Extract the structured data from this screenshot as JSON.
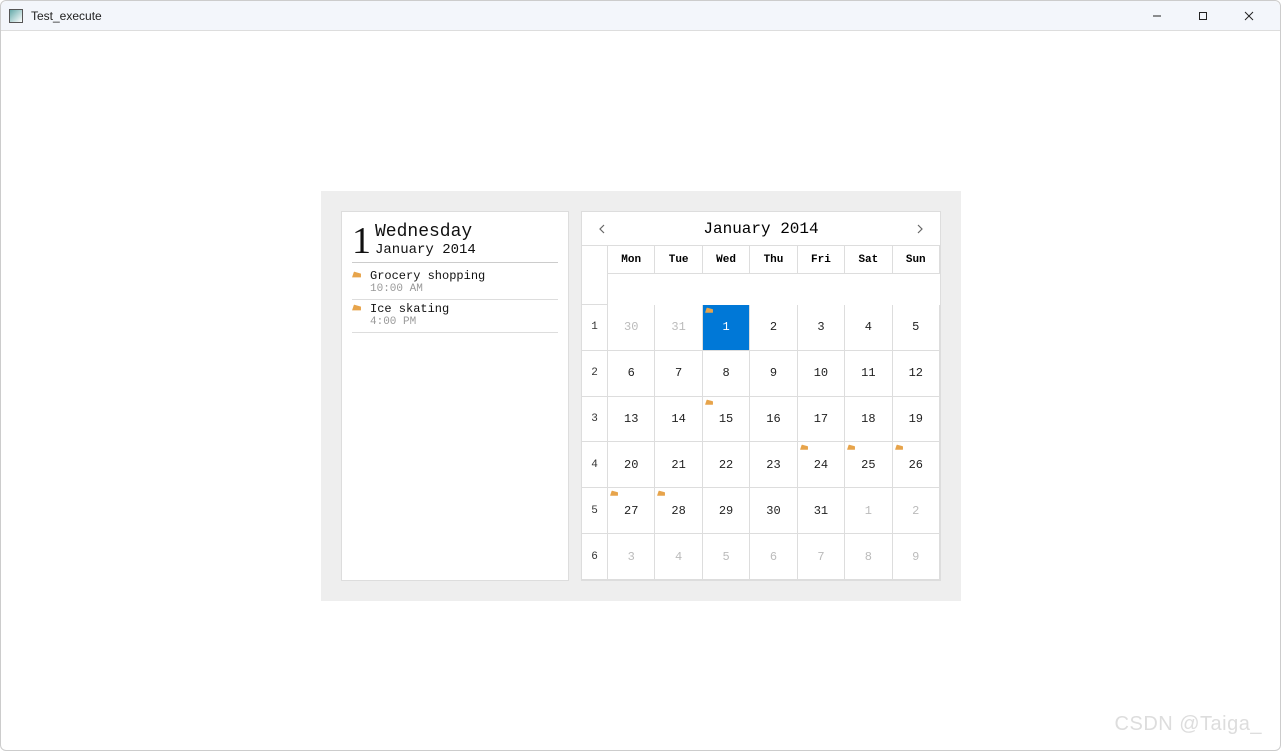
{
  "window": {
    "title": "Test_execute"
  },
  "day_panel": {
    "day_number": "1",
    "weekday": "Wednesday",
    "month_year": "January 2014",
    "events": [
      {
        "title": "Grocery shopping",
        "time": "10:00 AM"
      },
      {
        "title": "Ice skating",
        "time": "4:00 PM"
      }
    ]
  },
  "calendar": {
    "title": "January 2014",
    "dow": [
      "Mon",
      "Tue",
      "Wed",
      "Thu",
      "Fri",
      "Sat",
      "Sun"
    ],
    "weeks": [
      {
        "wk": "1",
        "days": [
          {
            "n": "30",
            "other": true
          },
          {
            "n": "31",
            "other": true
          },
          {
            "n": "1",
            "selected": true,
            "marker": true
          },
          {
            "n": "2"
          },
          {
            "n": "3"
          },
          {
            "n": "4"
          },
          {
            "n": "5"
          }
        ]
      },
      {
        "wk": "2",
        "days": [
          {
            "n": "6"
          },
          {
            "n": "7"
          },
          {
            "n": "8"
          },
          {
            "n": "9"
          },
          {
            "n": "10"
          },
          {
            "n": "11"
          },
          {
            "n": "12"
          }
        ]
      },
      {
        "wk": "3",
        "days": [
          {
            "n": "13"
          },
          {
            "n": "14"
          },
          {
            "n": "15",
            "marker": true
          },
          {
            "n": "16"
          },
          {
            "n": "17"
          },
          {
            "n": "18"
          },
          {
            "n": "19"
          }
        ]
      },
      {
        "wk": "4",
        "days": [
          {
            "n": "20"
          },
          {
            "n": "21"
          },
          {
            "n": "22"
          },
          {
            "n": "23"
          },
          {
            "n": "24",
            "marker": true
          },
          {
            "n": "25",
            "marker": true
          },
          {
            "n": "26",
            "marker": true
          }
        ]
      },
      {
        "wk": "5",
        "days": [
          {
            "n": "27",
            "marker": true
          },
          {
            "n": "28",
            "marker": true
          },
          {
            "n": "29"
          },
          {
            "n": "30"
          },
          {
            "n": "31"
          },
          {
            "n": "1",
            "other": true
          },
          {
            "n": "2",
            "other": true
          }
        ]
      },
      {
        "wk": "6",
        "days": [
          {
            "n": "3",
            "other": true
          },
          {
            "n": "4",
            "other": true
          },
          {
            "n": "5",
            "other": true
          },
          {
            "n": "6",
            "other": true
          },
          {
            "n": "7",
            "other": true
          },
          {
            "n": "8",
            "other": true
          },
          {
            "n": "9",
            "other": true
          }
        ]
      }
    ]
  },
  "watermark": "CSDN @Taiga_"
}
